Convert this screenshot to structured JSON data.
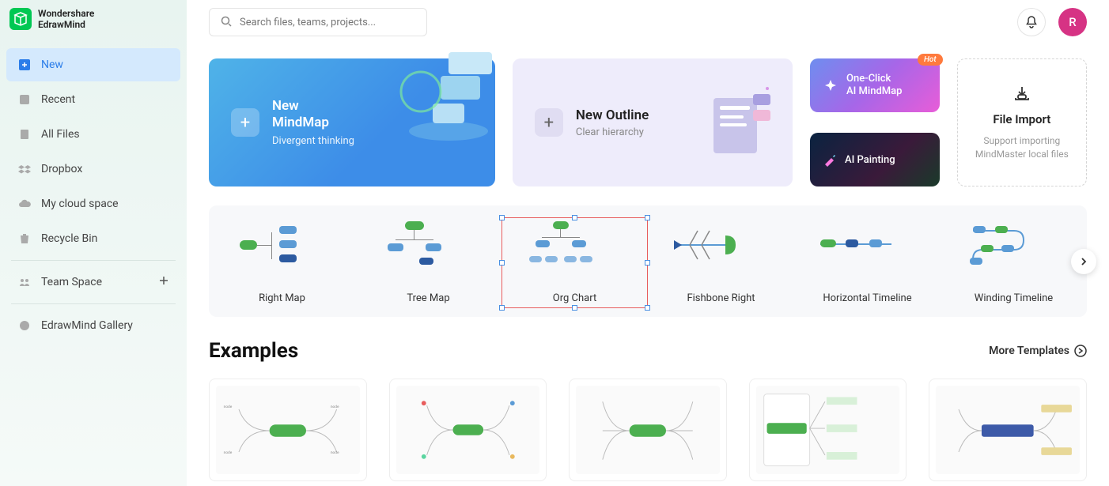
{
  "brand": {
    "line1": "Wondershare",
    "line2": "EdrawMind"
  },
  "sidebar": {
    "items": [
      {
        "label": "New",
        "icon": "plus-square"
      },
      {
        "label": "Recent",
        "icon": "clock"
      },
      {
        "label": "All Files",
        "icon": "file"
      },
      {
        "label": "Dropbox",
        "icon": "dropbox"
      },
      {
        "label": "My cloud space",
        "icon": "cloud"
      },
      {
        "label": "Recycle Bin",
        "icon": "trash"
      },
      {
        "label": "Team Space",
        "icon": "team"
      },
      {
        "label": "EdrawMind Gallery",
        "icon": "palette"
      }
    ]
  },
  "search": {
    "placeholder": "Search files, teams, projects..."
  },
  "avatar": {
    "initial": "R"
  },
  "hero": {
    "mindmap": {
      "title1": "New",
      "title2": "MindMap",
      "subtitle": "Divergent thinking"
    },
    "outline": {
      "title": "New Outline",
      "subtitle": "Clear hierarchy"
    },
    "ai_oneclick": {
      "line1": "One-Click",
      "line2": "AI MindMap",
      "badge": "Hot"
    },
    "ai_painting": {
      "label": "AI Painting"
    },
    "import": {
      "title": "File Import",
      "subtitle": "Support importing MindMaster local files"
    }
  },
  "templates": [
    {
      "label": "Right Map"
    },
    {
      "label": "Tree Map"
    },
    {
      "label": "Org Chart"
    },
    {
      "label": "Fishbone Right"
    },
    {
      "label": "Horizontal Timeline"
    },
    {
      "label": "Winding Timeline"
    }
  ],
  "examples": {
    "heading": "Examples",
    "more": "More Templates"
  }
}
